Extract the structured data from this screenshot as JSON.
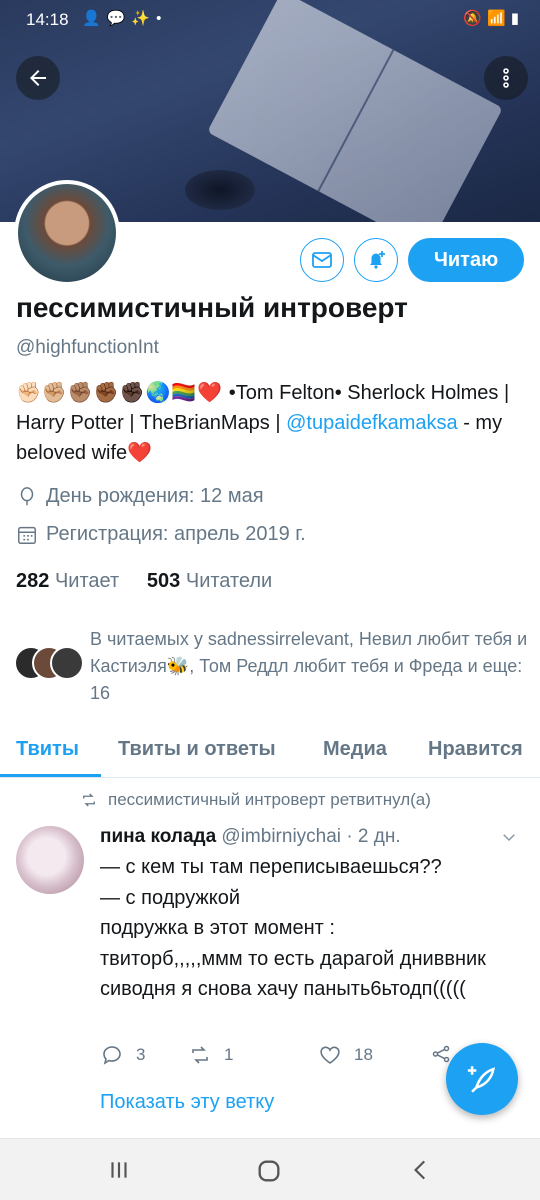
{
  "status_bar": {
    "time": "14:18",
    "left_icons": [
      "person-add-icon",
      "message-icon",
      "wand-icon",
      "dot-icon"
    ],
    "right_icons": [
      "mute-icon",
      "wifi-icon",
      "signal-icon",
      "signal-icon",
      "battery-icon"
    ]
  },
  "header": {
    "back_icon": "arrow-left-icon",
    "more_icon": "vertical-dots-icon"
  },
  "profile": {
    "follow_label": "Читаю",
    "name": "пессимистичный интроверт",
    "handle": "@highfunctionInt",
    "bio_emojis": "✊🏻✊🏼✊🏽✊🏾✊🏿🌏🏳️‍🌈❤️",
    "bio_text_1": "  •Tom Felton• Sherlock Holmes | Harry Potter | TheBrianMaps |",
    "bio_link": "@tupaidefkamaksa",
    "bio_text_2": " - my beloved wife❤️",
    "birthday": "День рождения: 12 мая",
    "joined": "Регистрация: апрель 2019 г.",
    "following_count": "282",
    "following_label": "Читает",
    "followers_count": "503",
    "followers_label": "Читатели",
    "followed_by_text": "В читаемых у sadnessirrelevant, Невил любит тебя и Кастиэля🐝, Том Реддл любит тебя и Фреда и еще: 16"
  },
  "tabs": [
    {
      "label": "Твиты",
      "active": true
    },
    {
      "label": "Твиты и ответы",
      "active": false
    },
    {
      "label": "Медиа",
      "active": false
    },
    {
      "label": "Нравится",
      "active": false
    }
  ],
  "tweet": {
    "retweet_text": "пессимистичный интроверт ретвитнул(а)",
    "author_name": "пина колада",
    "author_handle": "@imbirniychai",
    "time": "· 2 дн.",
    "text": "— с кем ты там переписываешься??\n— с подружкой\nподружка в этот момент :\nтвиторб,,,,,ммм то есть дарагой дниввник сиводня я снова хачу паныть6ьтодп(((((",
    "replies": "3",
    "retweets": "1",
    "likes": "18",
    "show_thread": "Показать эту ветку"
  },
  "colors": {
    "accent": "#1da1f2",
    "secondary_text": "#657786"
  }
}
